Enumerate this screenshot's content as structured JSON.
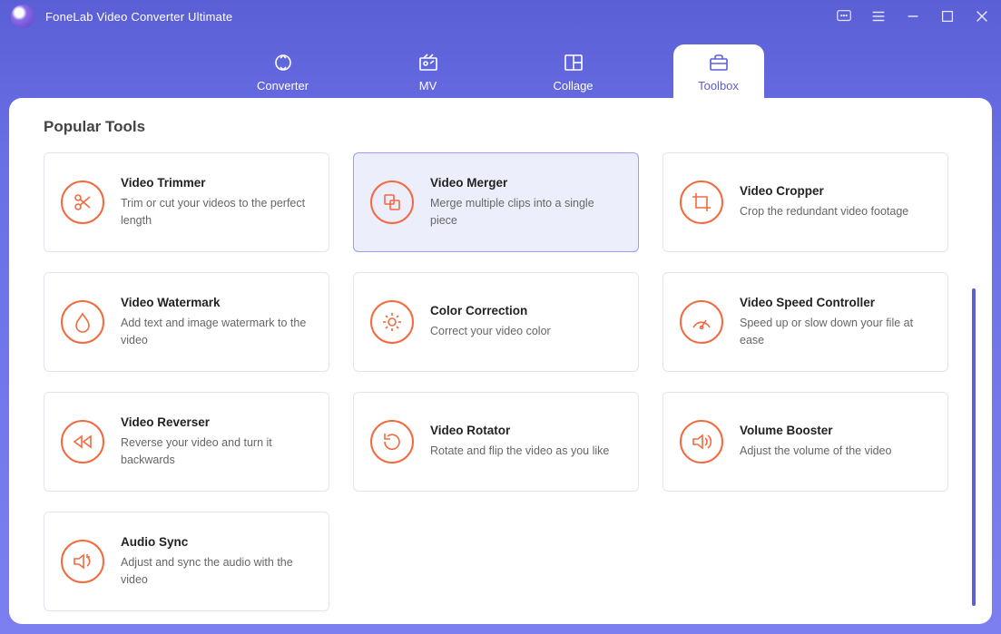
{
  "app": {
    "title": "FoneLab Video Converter Ultimate"
  },
  "nav": {
    "items": [
      {
        "label": "Converter"
      },
      {
        "label": "MV"
      },
      {
        "label": "Collage"
      },
      {
        "label": "Toolbox"
      }
    ],
    "activeIndex": 3
  },
  "section": {
    "title": "Popular Tools"
  },
  "tools": [
    {
      "title": "Video Trimmer",
      "desc": "Trim or cut your videos to the perfect length",
      "selected": false,
      "icon": "scissors"
    },
    {
      "title": "Video Merger",
      "desc": "Merge multiple clips into a single piece",
      "selected": true,
      "icon": "layers"
    },
    {
      "title": "Video Cropper",
      "desc": "Crop the redundant video footage",
      "selected": false,
      "icon": "crop"
    },
    {
      "title": "Video Watermark",
      "desc": "Add text and image watermark to the video",
      "selected": false,
      "icon": "drop"
    },
    {
      "title": "Color Correction",
      "desc": "Correct your video color",
      "selected": false,
      "icon": "sun"
    },
    {
      "title": "Video Speed Controller",
      "desc": "Speed up or slow down your file at ease",
      "selected": false,
      "icon": "gauge"
    },
    {
      "title": "Video Reverser",
      "desc": "Reverse your video and turn it backwards",
      "selected": false,
      "icon": "rewind"
    },
    {
      "title": "Video Rotator",
      "desc": "Rotate and flip the video as you like",
      "selected": false,
      "icon": "rotate"
    },
    {
      "title": "Volume Booster",
      "desc": "Adjust the volume of the video",
      "selected": false,
      "icon": "volume"
    },
    {
      "title": "Audio Sync",
      "desc": "Adjust and sync the audio with the video",
      "selected": false,
      "icon": "sync"
    }
  ]
}
